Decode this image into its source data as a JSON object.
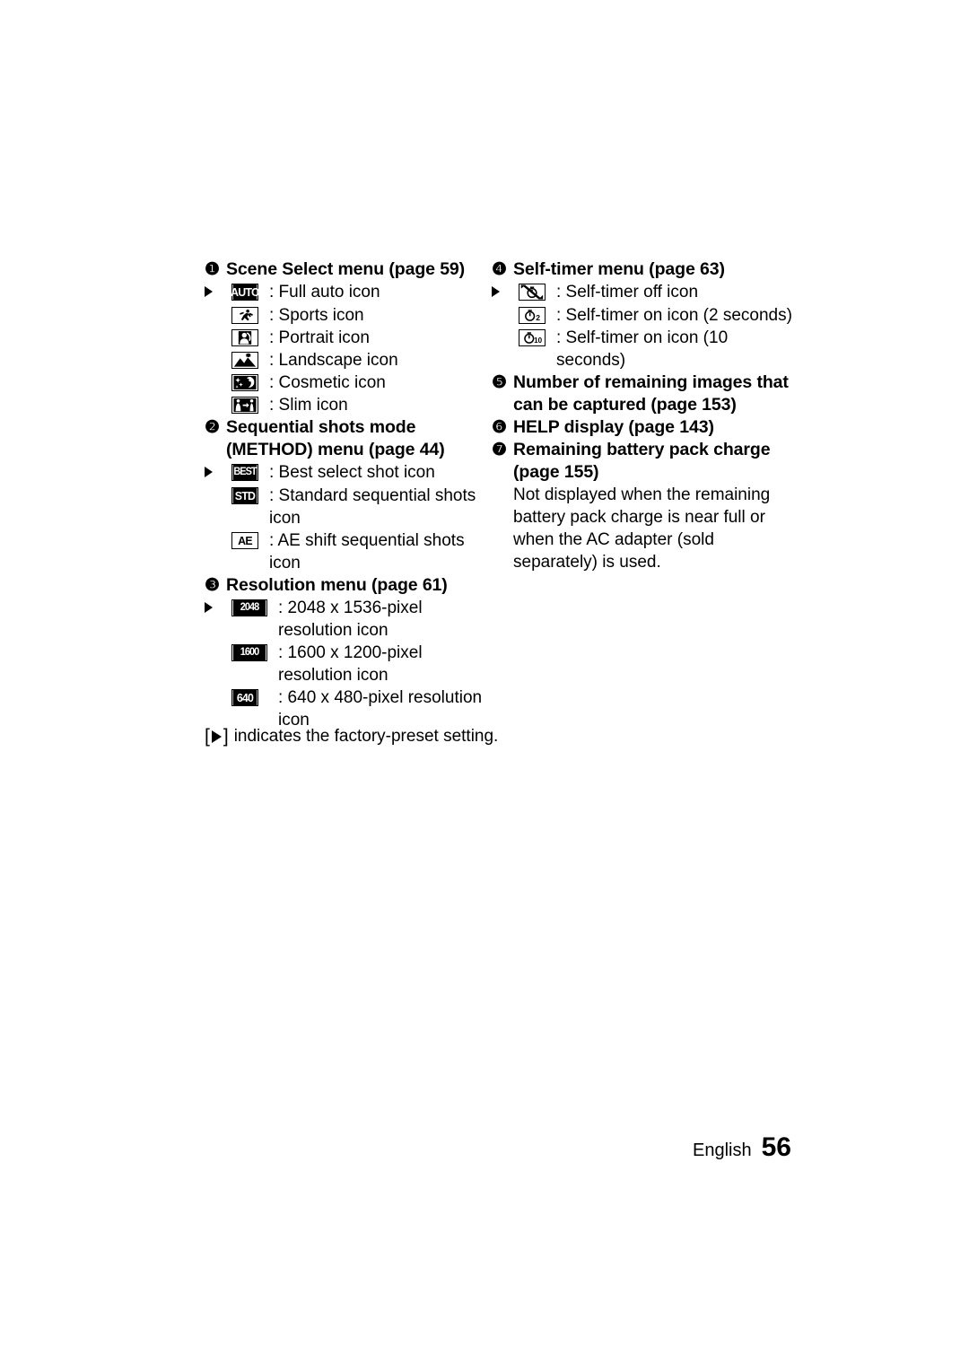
{
  "page": {
    "language": "English",
    "number": "56"
  },
  "footnote": {
    "open_bracket": "[",
    "close_bracket": "]",
    "text": "indicates the factory-preset setting."
  },
  "left_column": {
    "sections": [
      {
        "number": "❶",
        "title": "Scene Select menu (page 59)",
        "items": [
          {
            "marker": "▶",
            "icon": "auto-icon",
            "icon_text": "AUTO",
            "label": ": Full auto icon"
          },
          {
            "marker": "",
            "icon": "sports-icon",
            "icon_text": "",
            "label": ": Sports icon"
          },
          {
            "marker": "",
            "icon": "portrait-icon",
            "icon_text": "",
            "label": ": Portrait icon"
          },
          {
            "marker": "",
            "icon": "landscape-icon",
            "icon_text": "",
            "label": ": Landscape icon"
          },
          {
            "marker": "",
            "icon": "cosmetic-icon",
            "icon_text": "",
            "label": ": Cosmetic icon"
          },
          {
            "marker": "",
            "icon": "slim-icon",
            "icon_text": "",
            "label": ": Slim icon"
          }
        ]
      },
      {
        "number": "❷",
        "title": "Sequential shots mode (METHOD) menu (page 44)",
        "items": [
          {
            "marker": "▶",
            "icon": "best-icon",
            "icon_text": "BEST",
            "label": ": Best select shot icon"
          },
          {
            "marker": "",
            "icon": "std-icon",
            "icon_text": "STD",
            "label": ": Standard sequential shots icon"
          },
          {
            "marker": "",
            "icon": "ae-icon",
            "icon_text": "AE",
            "label": ": AE shift sequential shots icon"
          }
        ]
      },
      {
        "number": "❸",
        "title": "Resolution menu (page 61)",
        "items": [
          {
            "marker": "▶",
            "icon": "res-2048-icon",
            "icon_text": "2048",
            "label": ": 2048 x 1536-pixel resolution icon"
          },
          {
            "marker": "",
            "icon": "res-1600-icon",
            "icon_text": "1600",
            "label": ": 1600 x 1200-pixel resolution icon"
          },
          {
            "marker": "",
            "icon": "res-640-icon",
            "icon_text": "640",
            "label": ": 640 x 480-pixel resolution icon"
          }
        ]
      }
    ]
  },
  "right_column": {
    "sections": [
      {
        "number": "❹",
        "title": "Self-timer menu (page 63)",
        "items": [
          {
            "marker": "▶",
            "icon": "selftimer-off-icon",
            "icon_text": "",
            "label": ": Self-timer off icon"
          },
          {
            "marker": "",
            "icon": "selftimer-2s-icon",
            "icon_text": "2",
            "label": ": Self-timer on icon (2 seconds)"
          },
          {
            "marker": "",
            "icon": "selftimer-10s-icon",
            "icon_text": "10",
            "label": ": Self-timer on icon (10 seconds)"
          }
        ]
      },
      {
        "number": "❺",
        "title": "Number of remaining images that can be captured (page 153)",
        "items": []
      },
      {
        "number": "❻",
        "title": "HELP display (page 143)",
        "items": []
      },
      {
        "number": "❼",
        "title": "Remaining battery pack charge (page 155)",
        "body": "Not displayed when the remaining battery pack charge is near full or when the AC adapter (sold separately) is used.",
        "items": []
      }
    ]
  }
}
